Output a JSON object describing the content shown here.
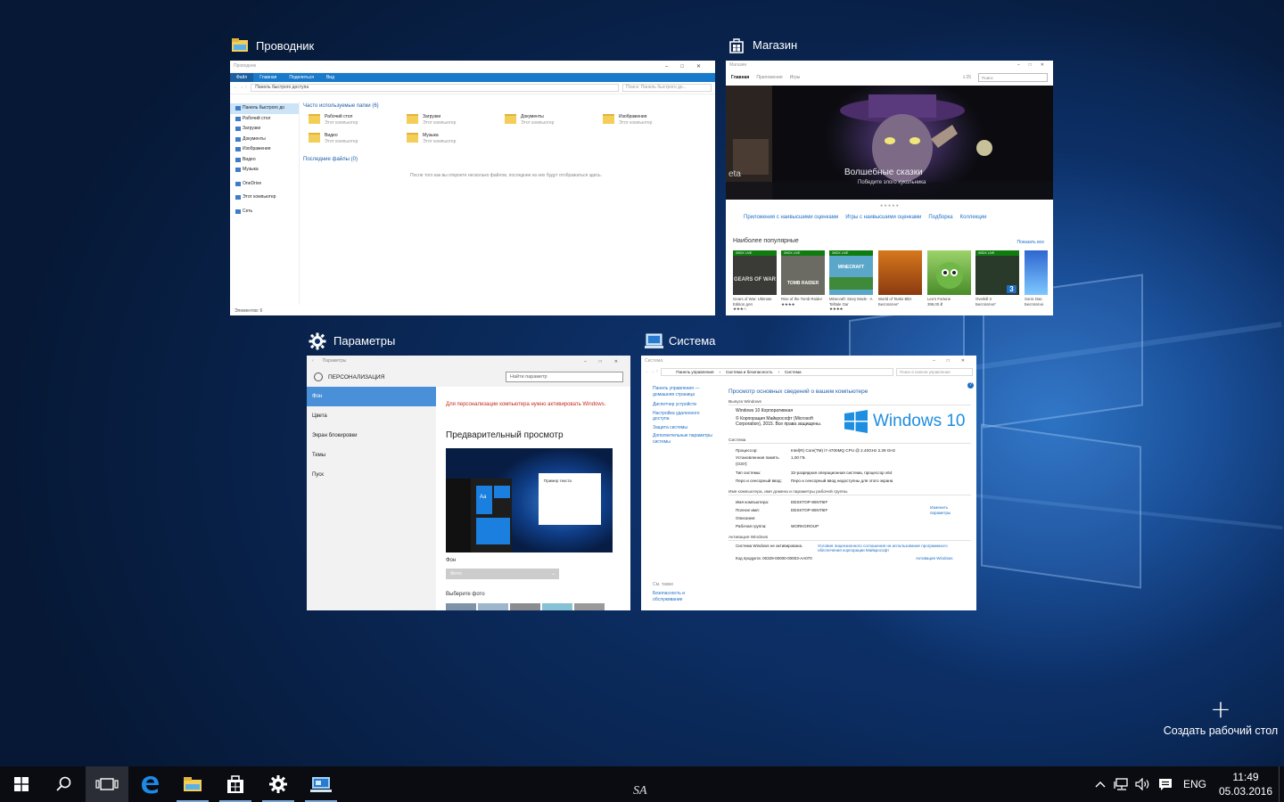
{
  "windows": {
    "explorer": {
      "title": "Проводник",
      "inner_title": "Проводник",
      "ribbon": [
        "Файл",
        "Главная",
        "Поделиться",
        "Вид"
      ],
      "address": "Панель быстрого доступа",
      "search_placeholder": "Поиск: Панель быстрого до...",
      "nav": [
        "Панель быстрого до",
        "Рабочий стол",
        "Загрузки",
        "Документы",
        "Изображения",
        "Видео",
        "Музыка",
        "OneDrive",
        "Этот компьютер",
        "Сеть"
      ],
      "frequent_header": "Часто используемые папки (6)",
      "folders": [
        {
          "name": "Рабочий стол",
          "sub": "Этот компьютер"
        },
        {
          "name": "Загрузки",
          "sub": "Этот компьютер"
        },
        {
          "name": "Документы",
          "sub": "Этот компьютер"
        },
        {
          "name": "Изображения",
          "sub": "Этот компьютер"
        },
        {
          "name": "Видео",
          "sub": "Этот компьютер"
        },
        {
          "name": "Музыка",
          "sub": "Этот компьютер"
        }
      ],
      "recent_header": "Последние файлы (0)",
      "recent_empty": "После того как вы откроете несколько файлов, последние из них будут отображаться здесь.",
      "status": "Элементов: 6"
    },
    "store": {
      "title": "Магазин",
      "inner_title": "Магазин",
      "tabs": [
        "Главная",
        "Приложения",
        "Игры"
      ],
      "downloads": "⇓25",
      "search_placeholder": "Поиск",
      "hero_title": "Волшебные сказки",
      "hero_sub": "Победите злого кукольника",
      "hero_left": "eta",
      "links": [
        "Приложения с наивысшими оценками",
        "Игры с наивысшими оценками",
        "Подборка",
        "Коллекции"
      ],
      "popular": "Наиболее популярные",
      "show_all": "Показать все",
      "xbox_badge": "XBOX LIVE",
      "apps": [
        {
          "name": "Gears of War: Ultimate Edition для",
          "tile": "GEARS OF WAR",
          "stars": "★★★☆"
        },
        {
          "name": "Rise of the Tomb Raider",
          "tile": "TOMB RAIDER",
          "stars": "★★★★"
        },
        {
          "name": "Minecraft: Story Mode - A Telltale Gar",
          "tile": "MINECRAFT",
          "stars": "★★★★"
        },
        {
          "name": "World of Tanks Blitz",
          "tile": "",
          "stars": "Бесплатно*"
        },
        {
          "name": "Leo's Fortune",
          "tile": "",
          "stars": "399,00 ₽"
        },
        {
          "name": "Overkill 3",
          "tile": "3",
          "stars": "Бесплатно*"
        },
        {
          "name": "Sonic Das",
          "tile": "",
          "stars": "Бесплатно"
        }
      ]
    },
    "settings": {
      "title": "Параметры",
      "inner_title": "Параметры",
      "section": "ПЕРСОНАЛИЗАЦИЯ",
      "search_placeholder": "Найти параметр",
      "menu": [
        "Фон",
        "Цвета",
        "Экран блокировки",
        "Темы",
        "Пуск"
      ],
      "warning": "Для персонализации компьютера нужно активировать Windows.",
      "preview_header": "Предварительный просмотр",
      "preview_text": "Пример текста",
      "preview_tile": "Аа",
      "bg_label": "Фон",
      "bg_value": "Фото",
      "choose_photo": "Выберите фото"
    },
    "system": {
      "title": "Система",
      "inner_title": "Система",
      "address": [
        "Панель управления",
        "Система и безопасность",
        "Система"
      ],
      "search_placeholder": "Поиск в панели управления",
      "side": [
        "Панель управления — домашняя страница",
        "Диспетчер устройств",
        "Настройка удаленного доступа",
        "Защита системы",
        "Дополнительные параметры системы"
      ],
      "see_also": "См. также",
      "see_also_link": "Безопасность и обслуживание",
      "header": "Просмотр основных сведений о вашем компьютере",
      "edition_label": "Выпуск Windows",
      "edition": "Windows 10 Корпоративная",
      "copyright": "© Корпорация Майкрософт (Microsoft Corporation), 2015. Все права защищены.",
      "logo_text": "Windows 10",
      "system_label": "Система",
      "rows": [
        {
          "k": "Процессор:",
          "v": "Intel(R) Core(TM) i7-4700MQ CPU @ 2.40GHz   2.39 GHz"
        },
        {
          "k": "Установленная память (ОЗУ):",
          "v": "1,00 ГБ"
        },
        {
          "k": "Тип системы:",
          "v": "32-разрядная операционная система, процессор x64"
        },
        {
          "k": "Перо и сенсорный ввод:",
          "v": "Перо и сенсорный ввод недоступны для этого экрана"
        }
      ],
      "name_label": "Имя компьютера, имя домена и параметры рабочей группы",
      "name_rows": [
        {
          "k": "Имя компьютера:",
          "v": "DESKTOP-86NT6IF"
        },
        {
          "k": "Полное имя:",
          "v": "DESKTOP-86NT6IF"
        },
        {
          "k": "Описание:",
          "v": ""
        },
        {
          "k": "Рабочая группа:",
          "v": "WORKGROUP"
        }
      ],
      "change_link": "Изменить параметры",
      "activation_label": "Активация Windows",
      "activation_status": "Система Windows не активирована.",
      "activation_link": "Условия лицензионного соглашения на использование программного обеспечения корпорации Майкрософт",
      "product_code": "Код продукта: 00329-00000-00003-AA070",
      "activate_link": "Активация Windows"
    }
  },
  "new_desktop": {
    "plus": "+",
    "label": "Создать рабочий стол"
  },
  "taskbar": {
    "lang": "ENG",
    "time": "11:49",
    "date": "05.03.2016",
    "watermark": "SA"
  },
  "colors": {
    "accent": "#1979ca",
    "taskbar": "#0b0c12"
  }
}
